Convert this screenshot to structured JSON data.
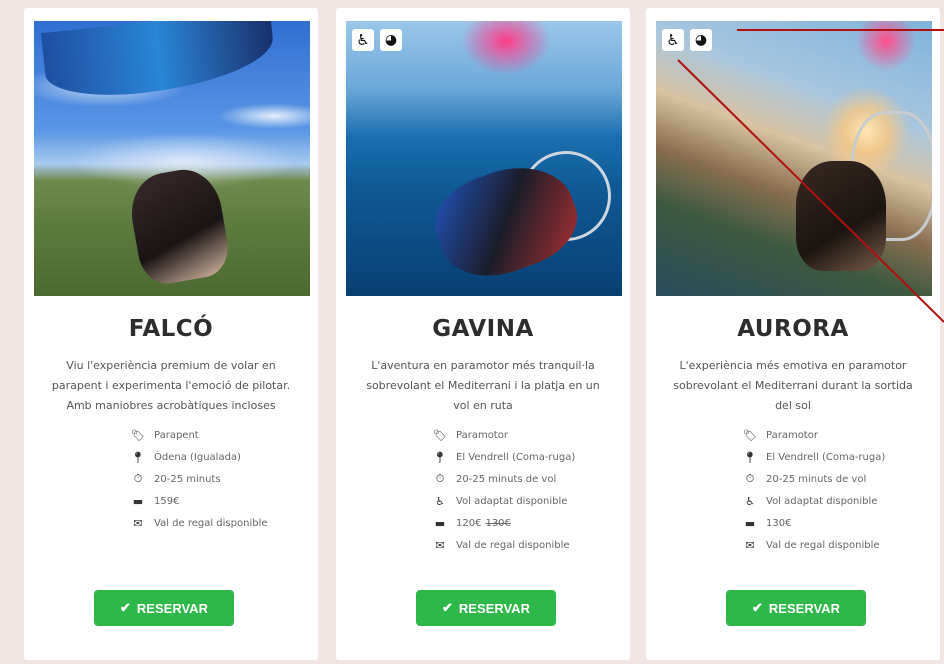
{
  "theme": {
    "page_bg": "#f1e6e3",
    "card_bg": "#ffffff",
    "button_green": "#2fb84a",
    "annotation_red": "#b01010"
  },
  "badges": {
    "wheelchair_icon": "adapted-flight-icon",
    "helmet_icon": "helmet-icon"
  },
  "cards": [
    {
      "title": "FALCÓ",
      "description": "Viu l'experiència premium de volar en parapent i experimenta l'emoció de pilotar. Amb maniobres acrobàtiques incloses",
      "details": {
        "type": "Parapent",
        "location": "Òdena (Igualada)",
        "duration": "20-25 minuts",
        "price": "159€",
        "gift": "Val de regal disponible"
      },
      "button": "RESERVAR"
    },
    {
      "title": "GAVINA",
      "description": "L'aventura en paramotor més tranquil·la sobrevolant el Mediterrani i la platja en un vol en ruta",
      "details": {
        "type": "Paramotor",
        "location": "El Vendrell (Coma-ruga)",
        "duration": "20-25 minuts de vol",
        "adapted": "Vol adaptat disponible",
        "price": "120€",
        "price_old": "130€",
        "gift": "Val de regal disponible"
      },
      "button": "RESERVAR"
    },
    {
      "title": "AURORA",
      "description": "L'experiència més emotiva en paramotor sobrevolant el Mediterrani durant la sortida del sol",
      "details": {
        "type": "Paramotor",
        "location": "El Vendrell (Coma-ruga)",
        "duration": "20-25 minuts de vol",
        "adapted": "Vol adaptat disponible",
        "price": "130€",
        "gift": "Val de regal disponible"
      },
      "button": "RESERVAR"
    }
  ]
}
